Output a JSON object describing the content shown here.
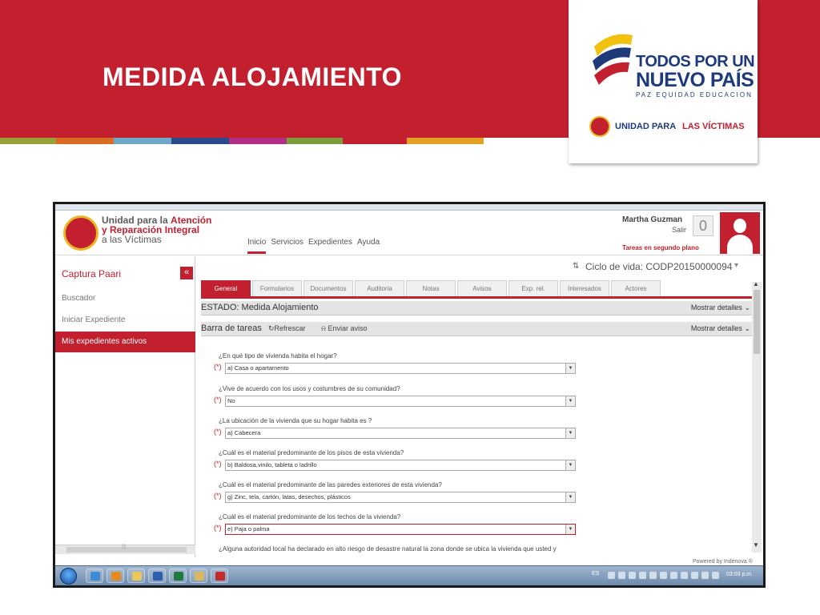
{
  "slide": {
    "title": "MEDIDA ALOJAMIENTO",
    "stripe_colors": [
      "#9aa03a",
      "#d96b22",
      "#6fa8c9",
      "#2b4a8c",
      "#b32f86",
      "#7d9d3d",
      "#c3202f",
      "#e3a126"
    ]
  },
  "logos": {
    "gov_line1": "TODOS POR UN",
    "gov_line2": "NUEVO PAÍS",
    "gov_line3": "PAZ  EQUIDAD  EDUCACION",
    "unit_text1": "UNIDAD PARA",
    "unit_text2": "LAS VÍCTIMAS"
  },
  "app": {
    "institution": {
      "line1_prefix": "Unidad para la ",
      "line1_accent": "Atención",
      "line2": "y Reparación Integral",
      "line3": "a las Víctimas"
    },
    "topnav": [
      "Inicio",
      "Servicios",
      "Expedientes",
      "Ayuda"
    ],
    "user": {
      "name": "Martha Guzman",
      "exit": "Salir",
      "task_count": "0",
      "bg_tasks": "Tareas en segundo plano"
    },
    "sidebar": {
      "title": "Captura Paari",
      "collapse_icon": "«",
      "items": [
        "Buscador",
        "Iniciar Expediente",
        "Mis expedientes activos"
      ]
    },
    "lifecycle": "Ciclo de vida: CODP20150000094",
    "tabs": [
      "General",
      "Formularios",
      "Documentos",
      "Auditoria",
      "Notas",
      "Avisos",
      "Exp. rel.",
      "Interesados",
      "Actores"
    ],
    "status": {
      "text": "ESTADO: Medida Alojamiento",
      "details": "Mostrar detalles"
    },
    "taskbar_section": {
      "title": "Barra de tareas",
      "refresh": "Refrescar",
      "notice": "Enviar aviso",
      "details": "Mostrar detalles"
    },
    "required_mark": "(*)",
    "questions": [
      {
        "label": "¿En qué tipo de vivienda habita el hogar?",
        "value": "a) Casa o apartamento"
      },
      {
        "label": "¿Vive de acuerdo con los usos y costumbres de su comunidad?",
        "value": "No"
      },
      {
        "label": "¿La ubicación de la vivienda que su hogar habita es ?",
        "value": "a) Cabecera"
      },
      {
        "label": "¿Cuál es el material predominante de los pisos de esta vivienda?",
        "value": "b) Baldosa,vinilo, tableta o ladrillo"
      },
      {
        "label": "¿Cuál es el material predominante de las paredes exteriores de esta vivienda?",
        "value": "g) Zinc, tela, cartón, latas, desechos, plásticos"
      },
      {
        "label": "¿Cuál es el material predominante de los techos de la vivienda?",
        "value": "e) Paja o palma"
      },
      {
        "label": "¿Alguna autoridad local ha declarado en alto riesgo de desastre natural la zona donde se ubica la vivienda que usted y",
        "value": ""
      }
    ],
    "powered_by": "Powered by Indenova ®",
    "windows": {
      "lang": "ES",
      "clock": "03:03 p.m."
    }
  }
}
